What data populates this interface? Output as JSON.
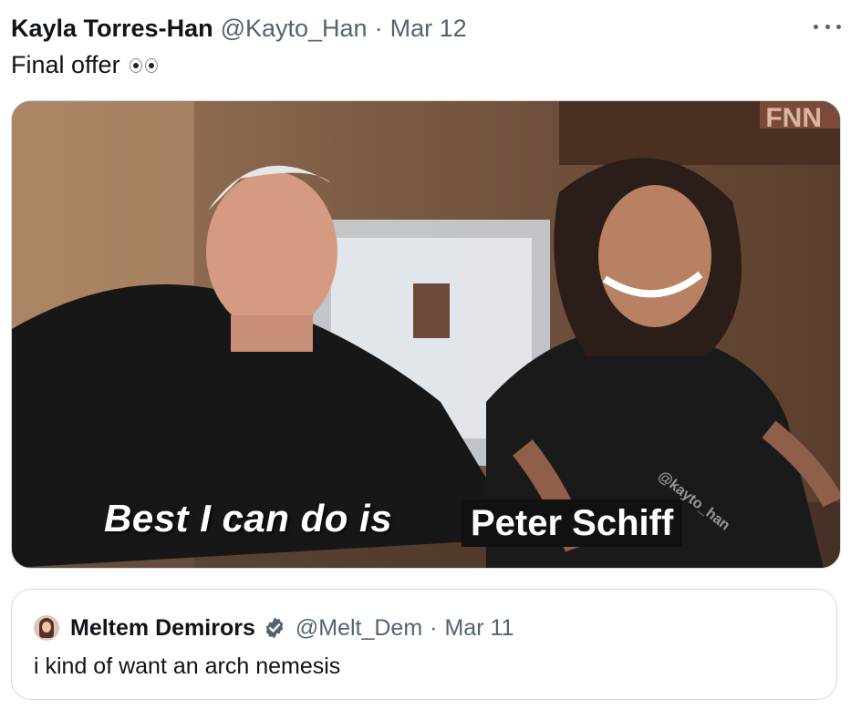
{
  "tweet": {
    "author_name": "Kayla Torres-Han",
    "author_handle": "@Kayto_Han",
    "separator": "·",
    "date": "Mar 12",
    "text": "Final offer",
    "emoji": "eyes-emoji"
  },
  "media": {
    "caption_main": "Best I can do is ",
    "caption_box": "Peter Schiff",
    "watermark": "@kayto_han",
    "sign_text": "FNN"
  },
  "quoted_tweet": {
    "author_name": "Meltem Demirors",
    "author_handle": "@Melt_Dem",
    "separator": "·",
    "date": "Mar 11",
    "text": "i kind of want an arch nemesis",
    "verified": true
  },
  "colors": {
    "text_primary": "#0f1419",
    "text_secondary": "#536471",
    "border": "#cfd9de",
    "verified": "#536471"
  }
}
